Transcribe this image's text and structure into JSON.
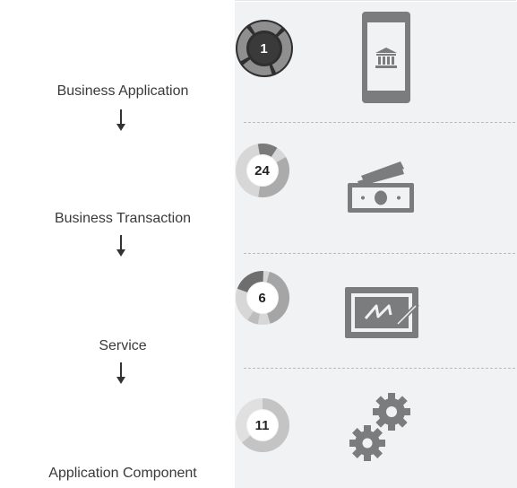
{
  "hierarchy": [
    {
      "count": "1",
      "label": "Business Application",
      "icon": "mobile-bank-icon"
    },
    {
      "count": "24",
      "label": "Business Transaction",
      "icon": "money-icon"
    },
    {
      "count": "6",
      "label": "Service",
      "icon": "monitor-signature-icon"
    },
    {
      "count": "11",
      "label": "Application Component",
      "icon": "gears-icon"
    }
  ],
  "colors": {
    "ring_dark": "#6b6b6b",
    "ring_mid": "#9a9a9a",
    "ring_light": "#c9c9c9",
    "ring_lighter": "#dcdcdc",
    "icon_gray": "#7b7c7e",
    "panel_bg": "#f1f2f4"
  }
}
